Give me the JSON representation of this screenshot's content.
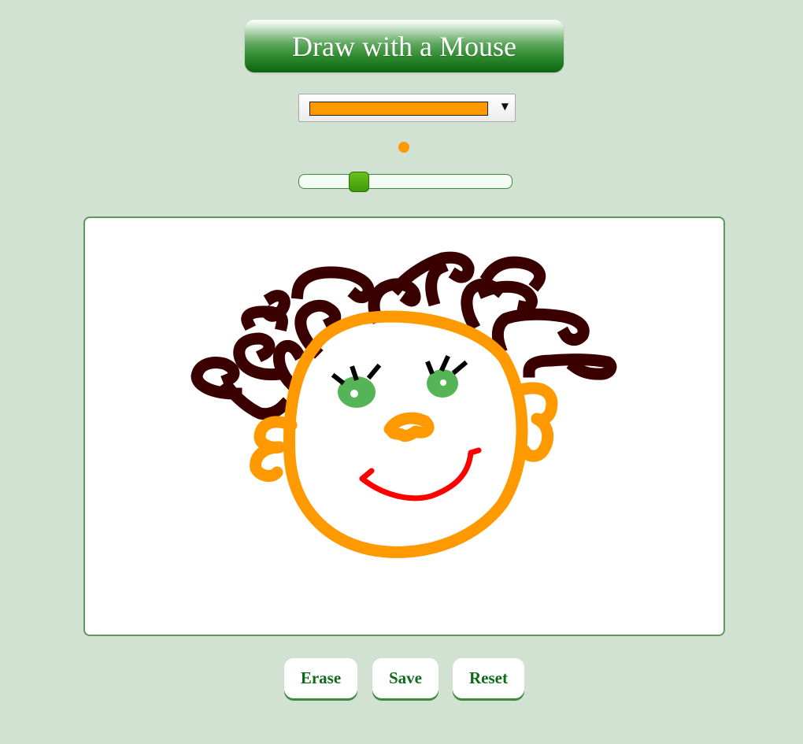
{
  "header": {
    "title": "Draw with a Mouse"
  },
  "toolbar": {
    "selected_color": "#ff9900",
    "brush_color": "#ff9900",
    "brush_size_fraction": 0.26
  },
  "actions": {
    "erase_label": "Erase",
    "save_label": "Save",
    "reset_label": "Reset"
  },
  "drawing": {
    "colors": {
      "hair": "#3a0000",
      "face": "#ff9900",
      "eyes": "#55b455",
      "lashes": "#000000",
      "mouth": "#ff0000"
    }
  }
}
